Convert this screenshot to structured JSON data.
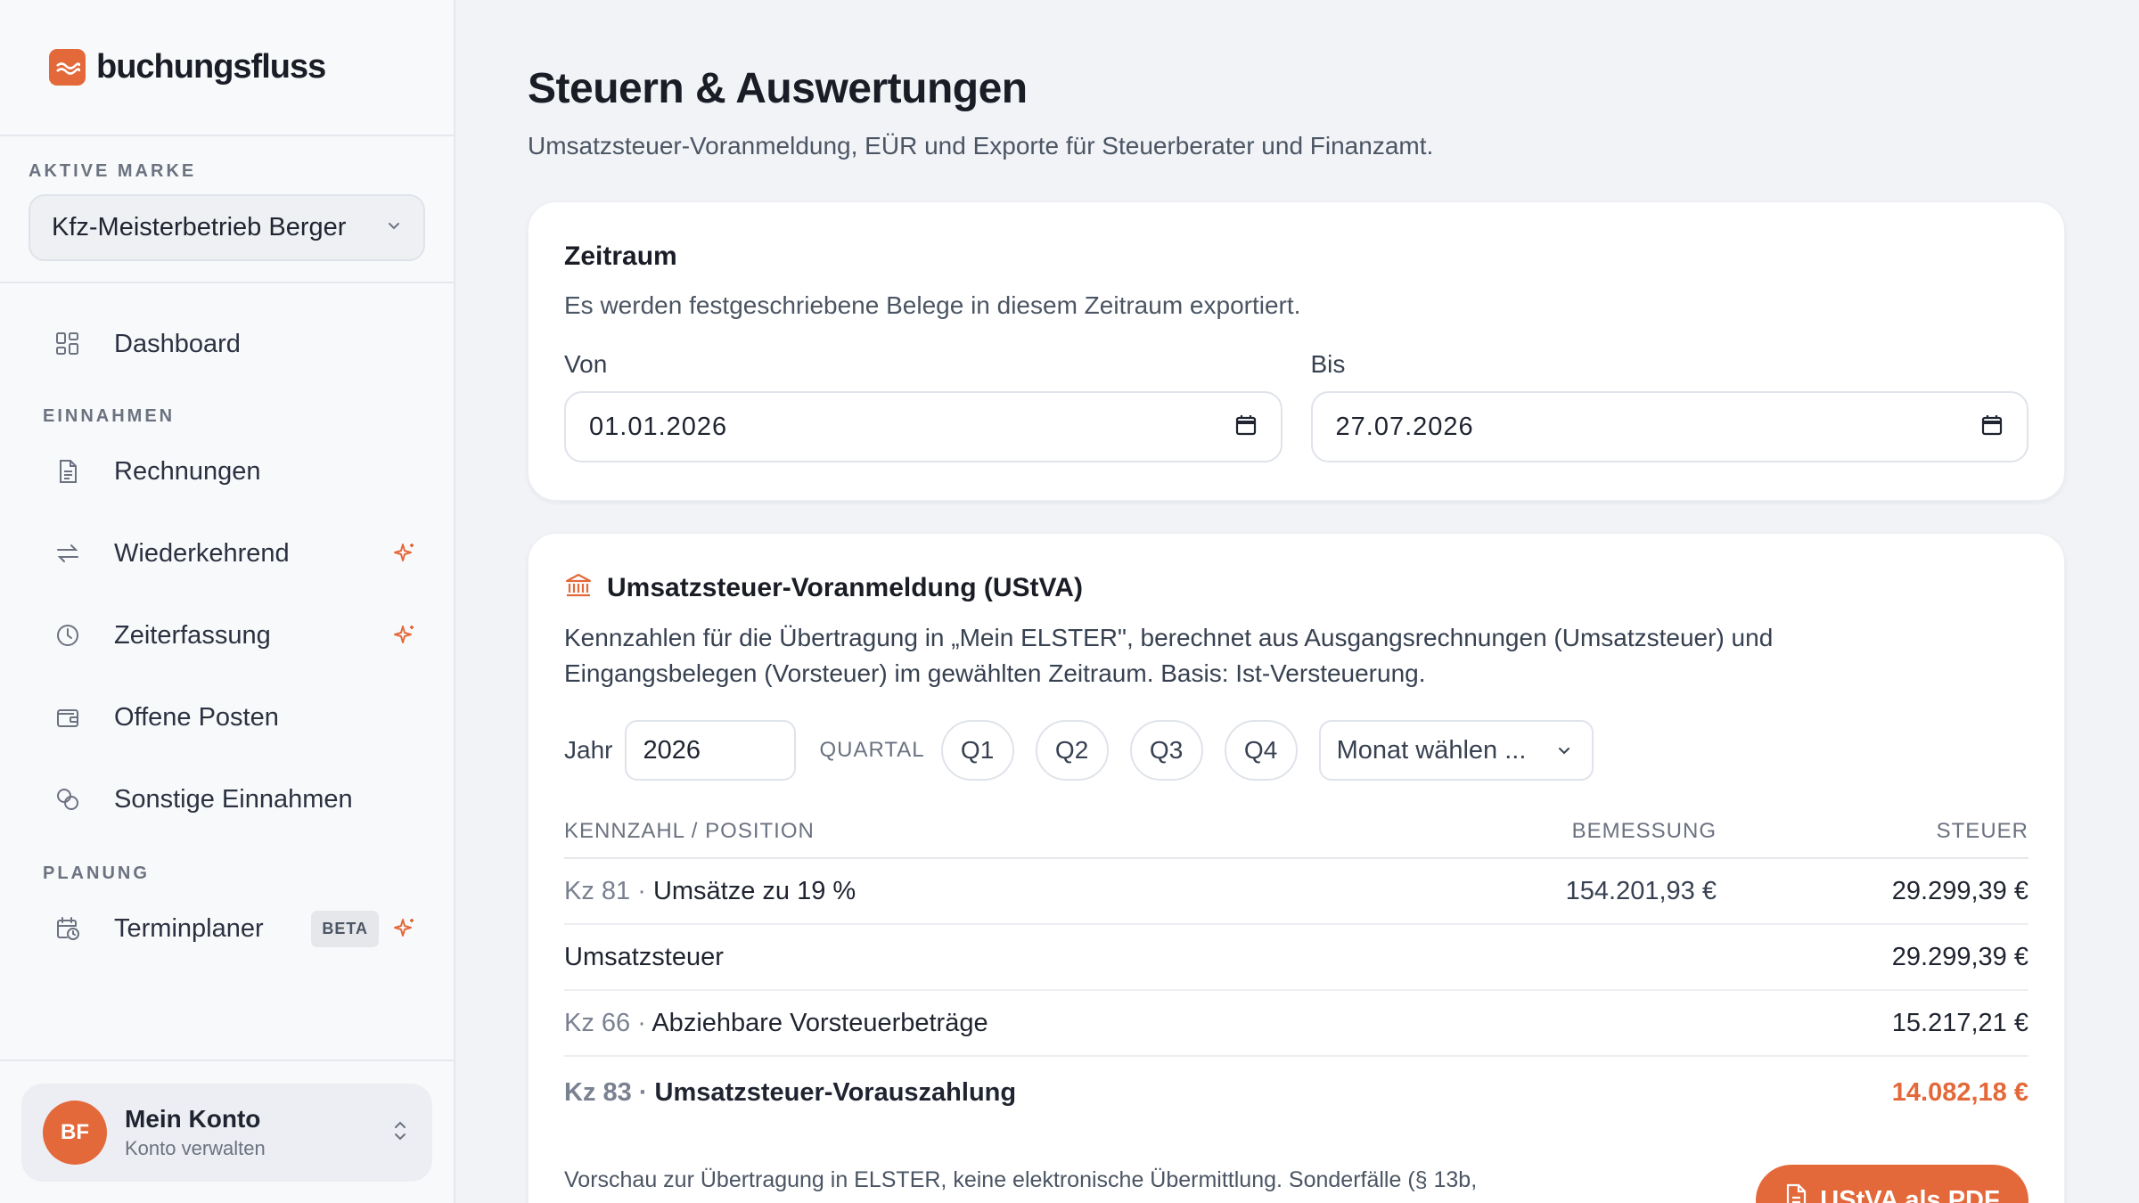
{
  "app": {
    "name": "buchungsfluss",
    "accent_color": "#e4693a"
  },
  "brand_section": {
    "label": "AKTIVE MARKE",
    "selected": "Kfz-Meisterbetrieb Berger"
  },
  "nav": {
    "dashboard": {
      "label": "Dashboard",
      "icon": "grid-icon"
    },
    "groups": [
      {
        "label": "EINNAHMEN",
        "items": [
          {
            "label": "Rechnungen",
            "icon": "document-icon"
          },
          {
            "label": "Wiederkehrend",
            "icon": "repeat-icon",
            "sparkle": true
          },
          {
            "label": "Zeiterfassung",
            "icon": "clock-icon",
            "sparkle": true
          },
          {
            "label": "Offene Posten",
            "icon": "wallet-icon"
          },
          {
            "label": "Sonstige Einnahmen",
            "icon": "coins-icon"
          }
        ]
      },
      {
        "label": "PLANUNG",
        "items": [
          {
            "label": "Terminplaner",
            "icon": "calendar-clock-icon",
            "badge": "BETA",
            "sparkle": true
          }
        ]
      }
    ]
  },
  "account": {
    "initials": "BF",
    "name": "Mein Konto",
    "subtitle": "Konto verwalten"
  },
  "page": {
    "title": "Steuern & Auswertungen",
    "subtitle": "Umsatzsteuer-Voranmeldung, EÜR und Exporte für Steuerberater und Finanzamt."
  },
  "zeitraum": {
    "title": "Zeitraum",
    "description": "Es werden festgeschriebene Belege in diesem Zeitraum exportiert.",
    "von_label": "Von",
    "von_value": "01.01.2026",
    "bis_label": "Bis",
    "bis_value": "27.07.2026"
  },
  "ustva": {
    "title": "Umsatzsteuer-Voranmeldung (UStVA)",
    "description": "Kennzahlen für die Übertragung in „Mein ELSTER\", berechnet aus Ausgangsrechnungen (Umsatzsteuer) und Eingangsbelegen (Vorsteuer) im gewählten Zeitraum. Basis: Ist-Versteuerung.",
    "year_label": "Jahr",
    "year_value": "2026",
    "quartal_label": "QUARTAL",
    "quarters": [
      "Q1",
      "Q2",
      "Q3",
      "Q4"
    ],
    "month_placeholder": "Monat wählen ...",
    "columns": {
      "position": "KENNZAHL / POSITION",
      "bemessung": "BEMESSUNG",
      "steuer": "STEUER"
    },
    "rows": [
      {
        "kz": "Kz 81",
        "sep": " · ",
        "label": "Umsätze zu 19 %",
        "bemessung": "154.201,93 €",
        "steuer": "29.299,39 €"
      },
      {
        "label": "Umsatzsteuer",
        "steuer": "29.299,39 €"
      },
      {
        "kz": "Kz 66",
        "sep": " · ",
        "label": "Abziehbare Vorsteuerbeträge",
        "steuer": "15.217,21 €"
      },
      {
        "kz": "Kz 83",
        "sep": " · ",
        "label": "Umsatzsteuer-Vorauszahlung",
        "steuer": "14.082,18 €"
      }
    ],
    "footnote": "Vorschau zur Übertragung in ELSTER, keine elektronische Übermittlung. Sonderfälle (§ 13b,",
    "pdf_button": "UStVA als PDF"
  }
}
